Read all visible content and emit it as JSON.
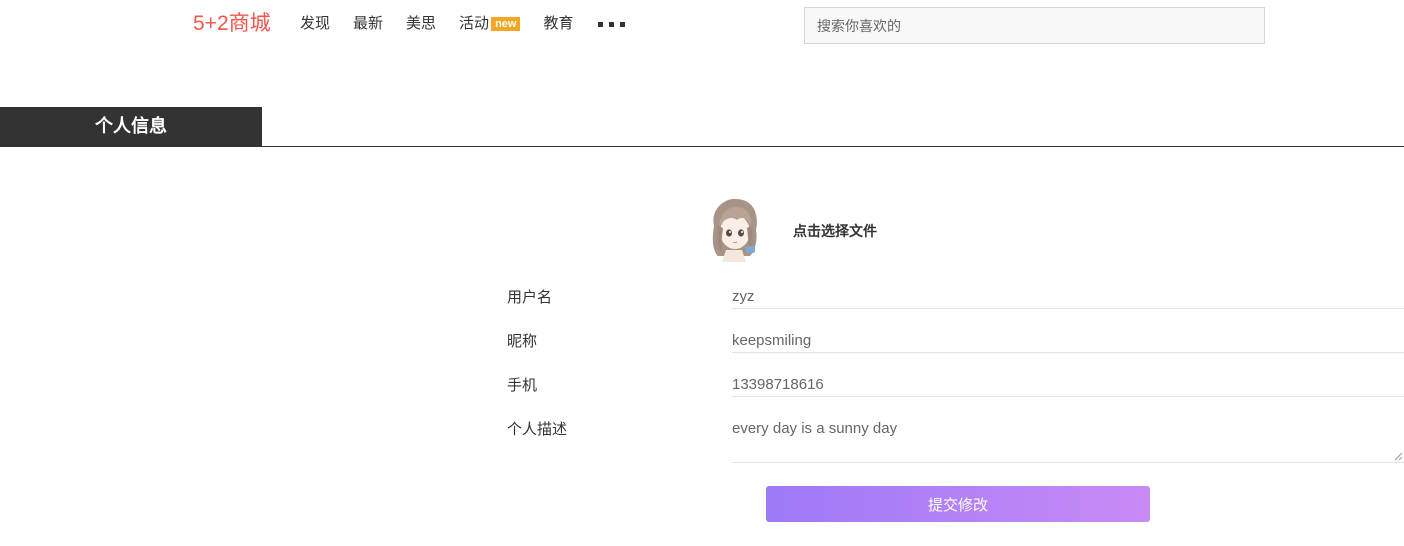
{
  "header": {
    "logo": "5+2商城",
    "nav": [
      {
        "label": "发现"
      },
      {
        "label": "最新"
      },
      {
        "label": "美思"
      },
      {
        "label": "活动",
        "badge": "new"
      },
      {
        "label": "教育"
      }
    ],
    "more_icon": "more-dots-icon",
    "search_placeholder": "搜索你喜欢的"
  },
  "section": {
    "title": "个人信息"
  },
  "profile": {
    "avatar_icon": "user-avatar",
    "choose_file_label": "点击选择文件",
    "fields": {
      "username": {
        "label": "用户名",
        "value": "zyz"
      },
      "nickname": {
        "label": "昵称",
        "value": "keepsmiling"
      },
      "phone": {
        "label": "手机",
        "value": "13398718616"
      },
      "description": {
        "label": "个人描述",
        "value": "every day is a sunny day"
      }
    },
    "submit_label": "提交修改"
  },
  "colors": {
    "logo": "#f0564a",
    "badge": "#f5a623",
    "section_tab_bg": "#333333",
    "button_gradient_start": "#9d79f7",
    "button_gradient_end": "#c98af5"
  }
}
